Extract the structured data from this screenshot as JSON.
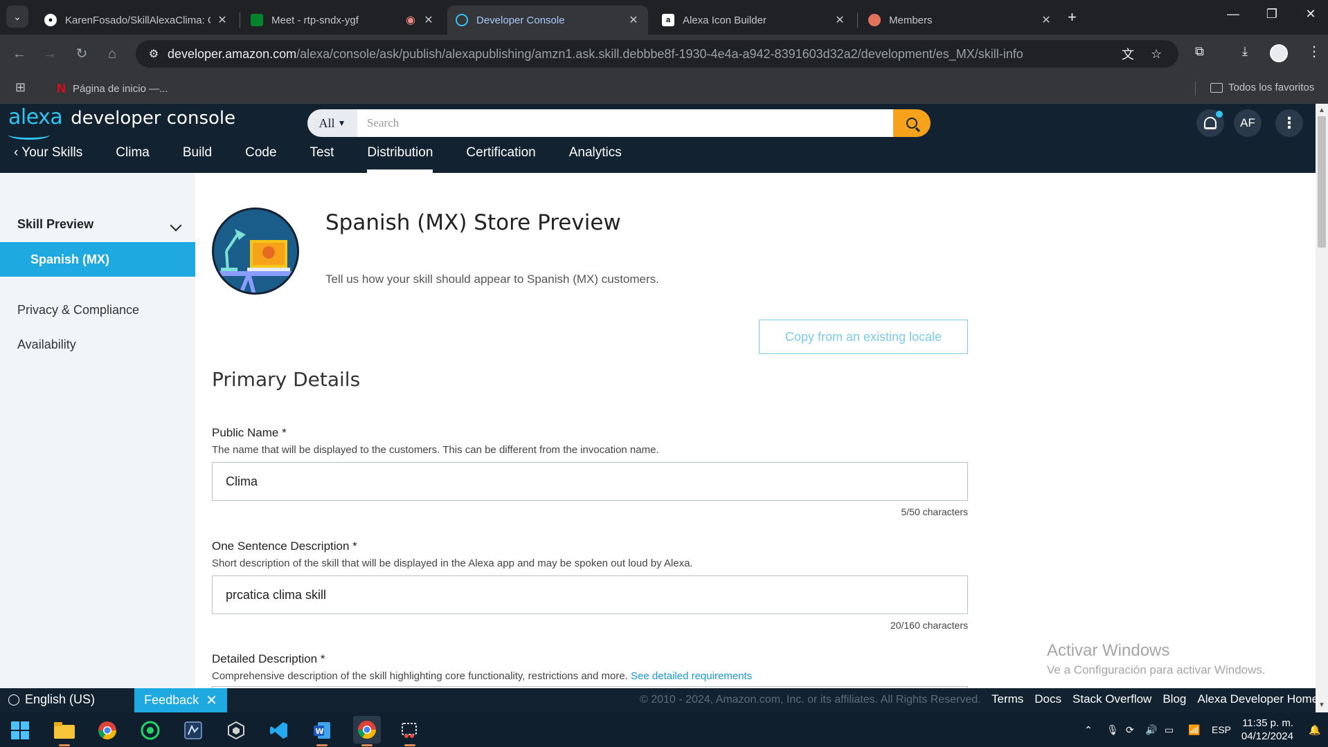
{
  "browser": {
    "tabs": [
      {
        "title": "KarenFosado/SkillAlexaClima: C",
        "icon": "github-icon"
      },
      {
        "title": "Meet - rtp-sndx-ygf",
        "icon": "meet-icon"
      },
      {
        "title": "Developer Console",
        "icon": "alexa-icon",
        "active": true
      },
      {
        "title": "Alexa Icon Builder",
        "icon": "amazon-icon"
      },
      {
        "title": "Members",
        "icon": "members-icon"
      }
    ],
    "url_host": "developer.amazon.com",
    "url_path": "/alexa/console/ask/publish/alexapublishing/amzn1.ask.skill.debbbe8f-1930-4e4a-a942-8391603d32a2/development/es_MX/skill-info",
    "bookmarks": [
      {
        "label": "Página de inicio —..."
      }
    ],
    "all_bookmarks_label": "Todos los favoritos"
  },
  "header": {
    "logo_alexa": "alexa",
    "logo_rest": "developer console",
    "search_scope": "All",
    "search_placeholder": "Search",
    "avatar_initials": "AF",
    "nav": [
      {
        "label": "Your Skills",
        "active": false
      },
      {
        "label": "Clima",
        "active": false
      },
      {
        "label": "Build",
        "active": false
      },
      {
        "label": "Code",
        "active": false
      },
      {
        "label": "Test",
        "active": false
      },
      {
        "label": "Distribution",
        "active": true
      },
      {
        "label": "Certification",
        "active": false
      },
      {
        "label": "Analytics",
        "active": false
      }
    ]
  },
  "sidebar": {
    "section_title": "Skill Preview",
    "active_item": "Spanish (MX)",
    "links": [
      "Privacy & Compliance",
      "Availability"
    ]
  },
  "main": {
    "title": "Spanish (MX) Store Preview",
    "subtitle": "Tell us how your skill should appear to Spanish (MX) customers.",
    "copy_button": "Copy from an existing locale",
    "section_title": "Primary Details",
    "fields": [
      {
        "label": "Public Name *",
        "help": "The name that will be displayed to the customers. This can be different from the invocation name.",
        "value": "Clima",
        "counter": "5/50 characters"
      },
      {
        "label": "One Sentence Description *",
        "help": "Short description of the skill that will be displayed in the Alexa app and may be spoken out loud by Alexa.",
        "value": "prcatica clima skill",
        "counter": "20/160 characters"
      },
      {
        "label": "Detailed Description *",
        "help": "Comprehensive description of the skill highlighting core functionality, restrictions and more.",
        "help_link": "See detailed requirements"
      }
    ]
  },
  "watermark": {
    "line1": "Activar Windows",
    "line2": "Ve a Configuración para activar Windows."
  },
  "footer": {
    "language": "English (US)",
    "feedback": "Feedback",
    "copyright": "© 2010 - 2024, Amazon.com, Inc. or its affiliates. All Rights Reserved.",
    "links": [
      "Terms",
      "Docs",
      "Stack Overflow",
      "Blog",
      "Alexa Developer Home"
    ]
  },
  "taskbar": {
    "lang": "ESP",
    "time": "11:35 p. m.",
    "date": "04/12/2024"
  },
  "colors": {
    "alexa_navy": "#132231",
    "alexa_blue": "#1fa9e1",
    "search_orange": "#f7a21b",
    "chrome_dark": "#202124"
  }
}
